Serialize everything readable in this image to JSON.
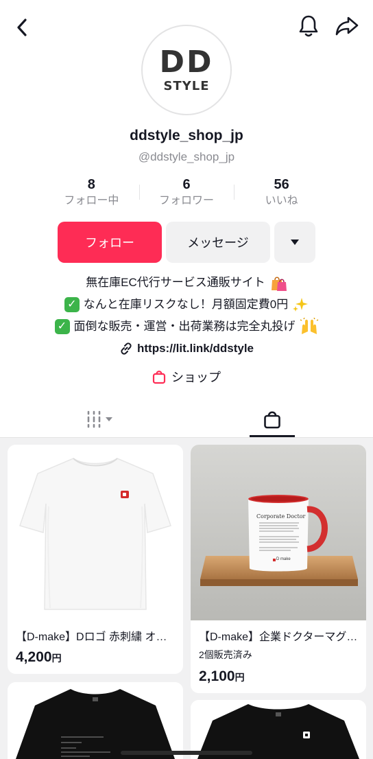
{
  "header": {
    "back_icon": "chevron-left-icon",
    "bell_icon": "bell-icon",
    "share_icon": "share-arrow-icon"
  },
  "profile": {
    "avatar_line1": "DD",
    "avatar_line2": "STYLE",
    "username": "ddstyle_shop_jp",
    "handle": "@ddstyle_shop_jp"
  },
  "stats": [
    {
      "value": "8",
      "label": "フォロー中"
    },
    {
      "value": "6",
      "label": "フォロワー"
    },
    {
      "value": "56",
      "label": "いいね"
    }
  ],
  "actions": {
    "follow_label": "フォロー",
    "message_label": "メッセージ",
    "more_icon": "caret-down-icon"
  },
  "bio": {
    "line1": "無在庫EC代行サービス通販サイト",
    "line2": "なんと在庫リスクなし！月額固定費0円",
    "line3": "面倒な販売・運営・出荷業務は完全丸投げ",
    "link": "https://lit.link/ddstyle"
  },
  "shop": {
    "label": "ショップ"
  },
  "tabs": {
    "videos_icon": "grid-columns-icon",
    "shop_icon": "shopping-bag-icon",
    "active": "shop"
  },
  "products": [
    {
      "title": "【D-make】Dロゴ 赤刺繍 オーバーサイズTシャツ",
      "sold": "",
      "price": "4,200",
      "currency": "円"
    },
    {
      "title": "【D-make】企業ドクターマグカップ",
      "sold": "2個販売済み",
      "price": "2,100",
      "currency": "円"
    }
  ],
  "mug_text": {
    "heading": "Corporate Doctor",
    "brand": "D make"
  },
  "colors": {
    "accent": "#fe2c55",
    "text": "#161823",
    "muted": "#8a8b91",
    "button_gray": "#f1f1f2",
    "check_green": "#3cb44a"
  }
}
